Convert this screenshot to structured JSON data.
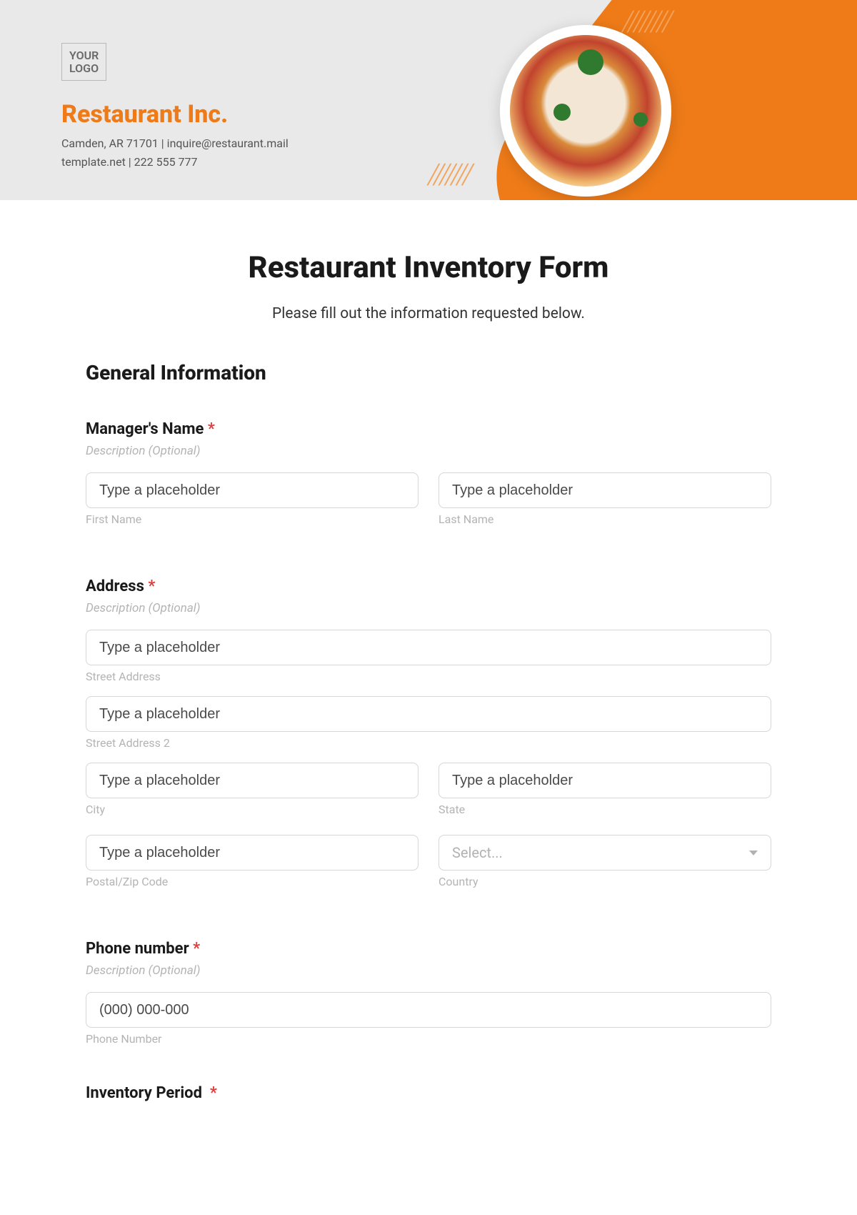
{
  "header": {
    "logo_line1": "YOUR",
    "logo_line2": "LOGO",
    "company_name": "Restaurant Inc.",
    "meta_line1": "Camden, AR 71701 | inquire@restaurant.mail",
    "meta_line2": "template.net | 222 555 777"
  },
  "title": "Restaurant Inventory Form",
  "subtitle": "Please fill out the information requested below.",
  "section_general": "General Information",
  "asterisk": "*",
  "desc_optional": "Description (Optional)",
  "fields": {
    "manager": {
      "label": "Manager's Name",
      "first_ph": "Type a placeholder",
      "last_ph": "Type a placeholder",
      "first_sub": "First Name",
      "last_sub": "Last Name"
    },
    "address": {
      "label": "Address",
      "street_ph": "Type a placeholder",
      "street_sub": "Street Address",
      "street2_ph": "Type a placeholder",
      "street2_sub": "Street Address 2",
      "city_ph": "Type a placeholder",
      "city_sub": "City",
      "state_ph": "Type a placeholder",
      "state_sub": "State",
      "postal_ph": "Type a placeholder",
      "postal_sub": "Postal/Zip Code",
      "country_ph": "Select...",
      "country_sub": "Country"
    },
    "phone": {
      "label": "Phone number",
      "ph": "(000) 000-000",
      "sub": "Phone Number"
    },
    "inventory": {
      "label": "Inventory Period"
    }
  }
}
